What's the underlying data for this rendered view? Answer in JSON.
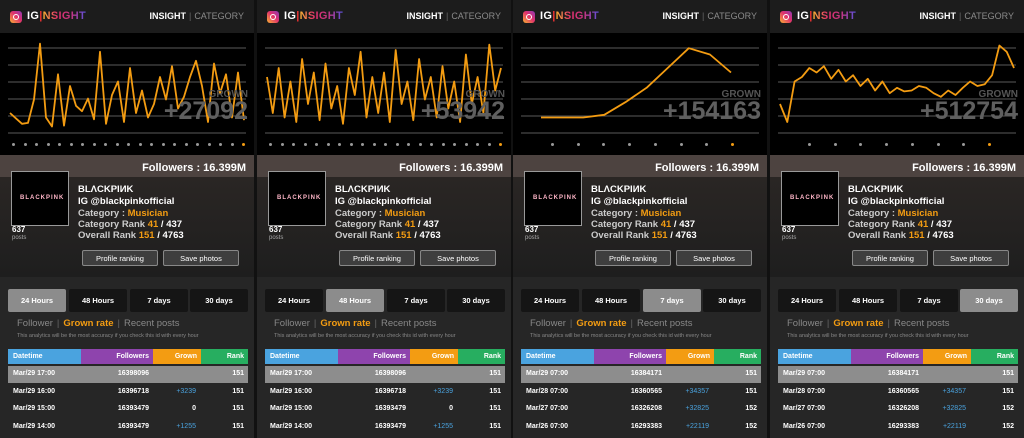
{
  "app": {
    "logo_ig": "IG",
    "logo_sep": "|",
    "logo_insight": "NSIGHT",
    "nav_insight": "INSIGHT",
    "nav_divider": "|",
    "nav_category": "CATEGORY"
  },
  "colors": {
    "accent": "#f39c12",
    "date_header": "#4aa3df",
    "followers_header": "#8e44ad",
    "grown_header": "#f39c12",
    "rank_header": "#27ae60"
  },
  "profile": {
    "followers": "Followers : 16.399M",
    "logo_word": "BLACKPINK",
    "name": "BLΛCKPIИK",
    "handle": "IG @blackpinkofficial",
    "category_key": "Category :",
    "category": "Musician",
    "category_rank_key": "Category Rank",
    "category_rank": "41",
    "category_rank_total": "/ 437",
    "overall_rank_key": "Overall Rank",
    "overall_rank": "151",
    "overall_rank_total": "/ 4763",
    "posts_count": "637",
    "posts_label": "posts",
    "btn_profile_ranking": "Profile ranking",
    "btn_save_photos": "Save photos"
  },
  "tabs": [
    "24 Hours",
    "48 Hours",
    "7 days",
    "30 days"
  ],
  "subtabs": {
    "follower": "Follower",
    "grown_rate": "Grown rate",
    "recent_posts": "Recent posts",
    "sep": "|"
  },
  "note": "This analytics will be the most accuracy if you check this id with every hour",
  "table_headers": {
    "datetime": "Datetime",
    "followers": "Followers",
    "grown": "Grown",
    "rank": "Rank"
  },
  "panels": [
    {
      "active_tab": 0,
      "grown_label": "GROWN",
      "grown_value": "+27092",
      "chart_data": {
        "type": "line",
        "values": [
          20,
          14,
          8,
          9,
          35,
          97,
          15,
          5,
          63,
          6,
          50,
          28,
          22,
          36,
          13,
          88,
          8,
          40,
          55,
          10,
          70,
          20,
          45,
          15,
          30,
          60,
          35,
          72,
          25,
          38,
          60,
          78,
          50,
          10,
          75,
          42,
          63,
          15,
          65,
          12
        ]
      },
      "dots_total": 21,
      "dots_active": 20,
      "rows": [
        {
          "date": "Mar/29 17:00",
          "followers": "16398096",
          "grown": "",
          "rank": "151"
        },
        {
          "date": "Mar/29 16:00",
          "followers": "16396718",
          "grown": "+3239",
          "rank": "151"
        },
        {
          "date": "Mar/29 15:00",
          "followers": "16393479",
          "grown": "0",
          "rank": "151"
        },
        {
          "date": "Mar/29 14:00",
          "followers": "16393479",
          "grown": "+1255",
          "rank": "151"
        }
      ]
    },
    {
      "active_tab": 1,
      "grown_label": "GROWN",
      "grown_value": "+53942",
      "chart_data": {
        "type": "line",
        "values": [
          60,
          20,
          70,
          15,
          55,
          10,
          80,
          30,
          65,
          12,
          75,
          25,
          50,
          8,
          70,
          40,
          88,
          15,
          60,
          20,
          65,
          10,
          90,
          30,
          55,
          12,
          80,
          35,
          60,
          15,
          72,
          25,
          55,
          10,
          85,
          30,
          60,
          20,
          96,
          45,
          70
        ]
      },
      "dots_total": 21,
      "dots_active": 20,
      "rows": [
        {
          "date": "Mar/29 17:00",
          "followers": "16398096",
          "grown": "",
          "rank": "151"
        },
        {
          "date": "Mar/29 16:00",
          "followers": "16396718",
          "grown": "+3239",
          "rank": "151"
        },
        {
          "date": "Mar/29 15:00",
          "followers": "16393479",
          "grown": "0",
          "rank": "151"
        },
        {
          "date": "Mar/29 14:00",
          "followers": "16393479",
          "grown": "+1255",
          "rank": "151"
        }
      ]
    },
    {
      "active_tab": 2,
      "grown_label": "GROWN",
      "grown_value": "+154163",
      "chart_data": {
        "type": "line",
        "values": [
          15,
          15,
          15,
          18,
          32,
          48,
          70,
          92,
          85,
          65
        ]
      },
      "dots_total": 8,
      "dots_active": 7,
      "rows": [
        {
          "date": "Mar/29 07:00",
          "followers": "16384171",
          "grown": "",
          "rank": "151"
        },
        {
          "date": "Mar/28 07:00",
          "followers": "16360565",
          "grown": "+34357",
          "rank": "151"
        },
        {
          "date": "Mar/27 07:00",
          "followers": "16326208",
          "grown": "+32825",
          "rank": "152"
        },
        {
          "date": "Mar/26 07:00",
          "followers": "16293383",
          "grown": "+22119",
          "rank": "152"
        }
      ]
    },
    {
      "active_tab": 3,
      "grown_label": "GROWN",
      "grown_value": "+512754",
      "chart_data": {
        "type": "line",
        "values": [
          30,
          10,
          55,
          60,
          70,
          65,
          72,
          58,
          68,
          55,
          62,
          50,
          58,
          45,
          55,
          42,
          48,
          44,
          45,
          50,
          48,
          42,
          38,
          45,
          40,
          48,
          55,
          50,
          52,
          62,
          95,
          88,
          70
        ]
      },
      "dots_total": 8,
      "dots_active": 7,
      "rows": [
        {
          "date": "Mar/29 07:00",
          "followers": "16384171",
          "grown": "",
          "rank": "151"
        },
        {
          "date": "Mar/28 07:00",
          "followers": "16360565",
          "grown": "+34357",
          "rank": "151"
        },
        {
          "date": "Mar/27 07:00",
          "followers": "16326208",
          "grown": "+32825",
          "rank": "152"
        },
        {
          "date": "Mar/26 07:00",
          "followers": "16293383",
          "grown": "+22119",
          "rank": "152"
        }
      ]
    }
  ]
}
